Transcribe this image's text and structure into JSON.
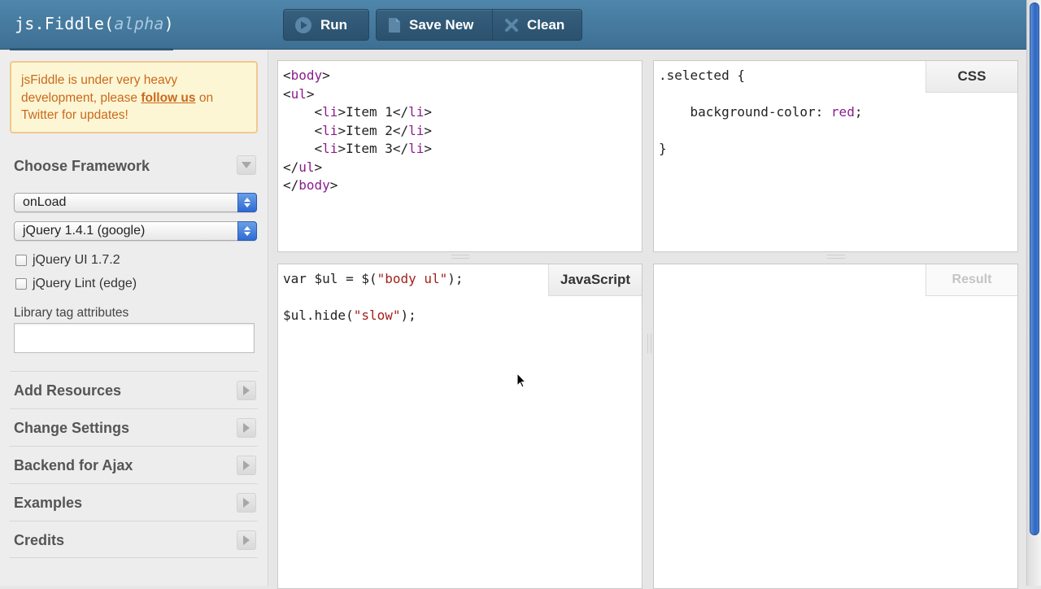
{
  "header": {
    "logo_main": "js.Fiddle(",
    "logo_alpha": "alpha",
    "logo_close": ")",
    "run_label": "Run",
    "save_label": "Save New",
    "clean_label": "Clean"
  },
  "sidebar": {
    "notice": {
      "text_before": "jsFiddle is under very heavy development, please ",
      "link": "follow us",
      "text_after": " on Twitter for updates!"
    },
    "framework_title": "Choose Framework",
    "load_select": "onLoad",
    "framework_select": "jQuery 1.4.1 (google)",
    "checkboxes": [
      {
        "label": "jQuery UI 1.7.2",
        "checked": false
      },
      {
        "label": "jQuery Lint (edge)",
        "checked": false
      }
    ],
    "lib_label": "Library tag attributes",
    "lib_value": "",
    "sections": [
      "Add Resources",
      "Change Settings",
      "Backend for Ajax",
      "Examples",
      "Credits"
    ]
  },
  "panels": {
    "html_lines": [
      [
        "<",
        "body",
        ">"
      ],
      [
        "<",
        "ul",
        ">"
      ],
      [
        "    <",
        "li",
        ">Item 1</",
        "li",
        ">"
      ],
      [
        "    <",
        "li",
        ">Item 2</",
        "li",
        ">"
      ],
      [
        "    <",
        "li",
        ">Item 3</",
        "li",
        ">"
      ],
      [
        "</",
        "ul",
        ">"
      ],
      [
        "</",
        "body",
        ">"
      ]
    ],
    "css_tab": "CSS",
    "css": {
      "selector": ".selected {",
      "property": "    background-color: ",
      "value": "red",
      "semicolon": ";",
      "close": "}"
    },
    "js_tab": "JavaScript",
    "js": {
      "line1_pre": "var $ul = $(",
      "line1_str": "\"body ul\"",
      "line1_post": ");",
      "line2_pre": "$ul.hide(",
      "line2_str": "\"slow\"",
      "line2_post": ");"
    },
    "result_tab": "Result"
  },
  "colors": {
    "header": "#4a7fa3",
    "button_group": "#2f5674",
    "notice_text": "#c96a1c",
    "notice_bg": "#fdf6d5",
    "code_tag": "#8b1d8d",
    "code_string": "#a3211c"
  }
}
